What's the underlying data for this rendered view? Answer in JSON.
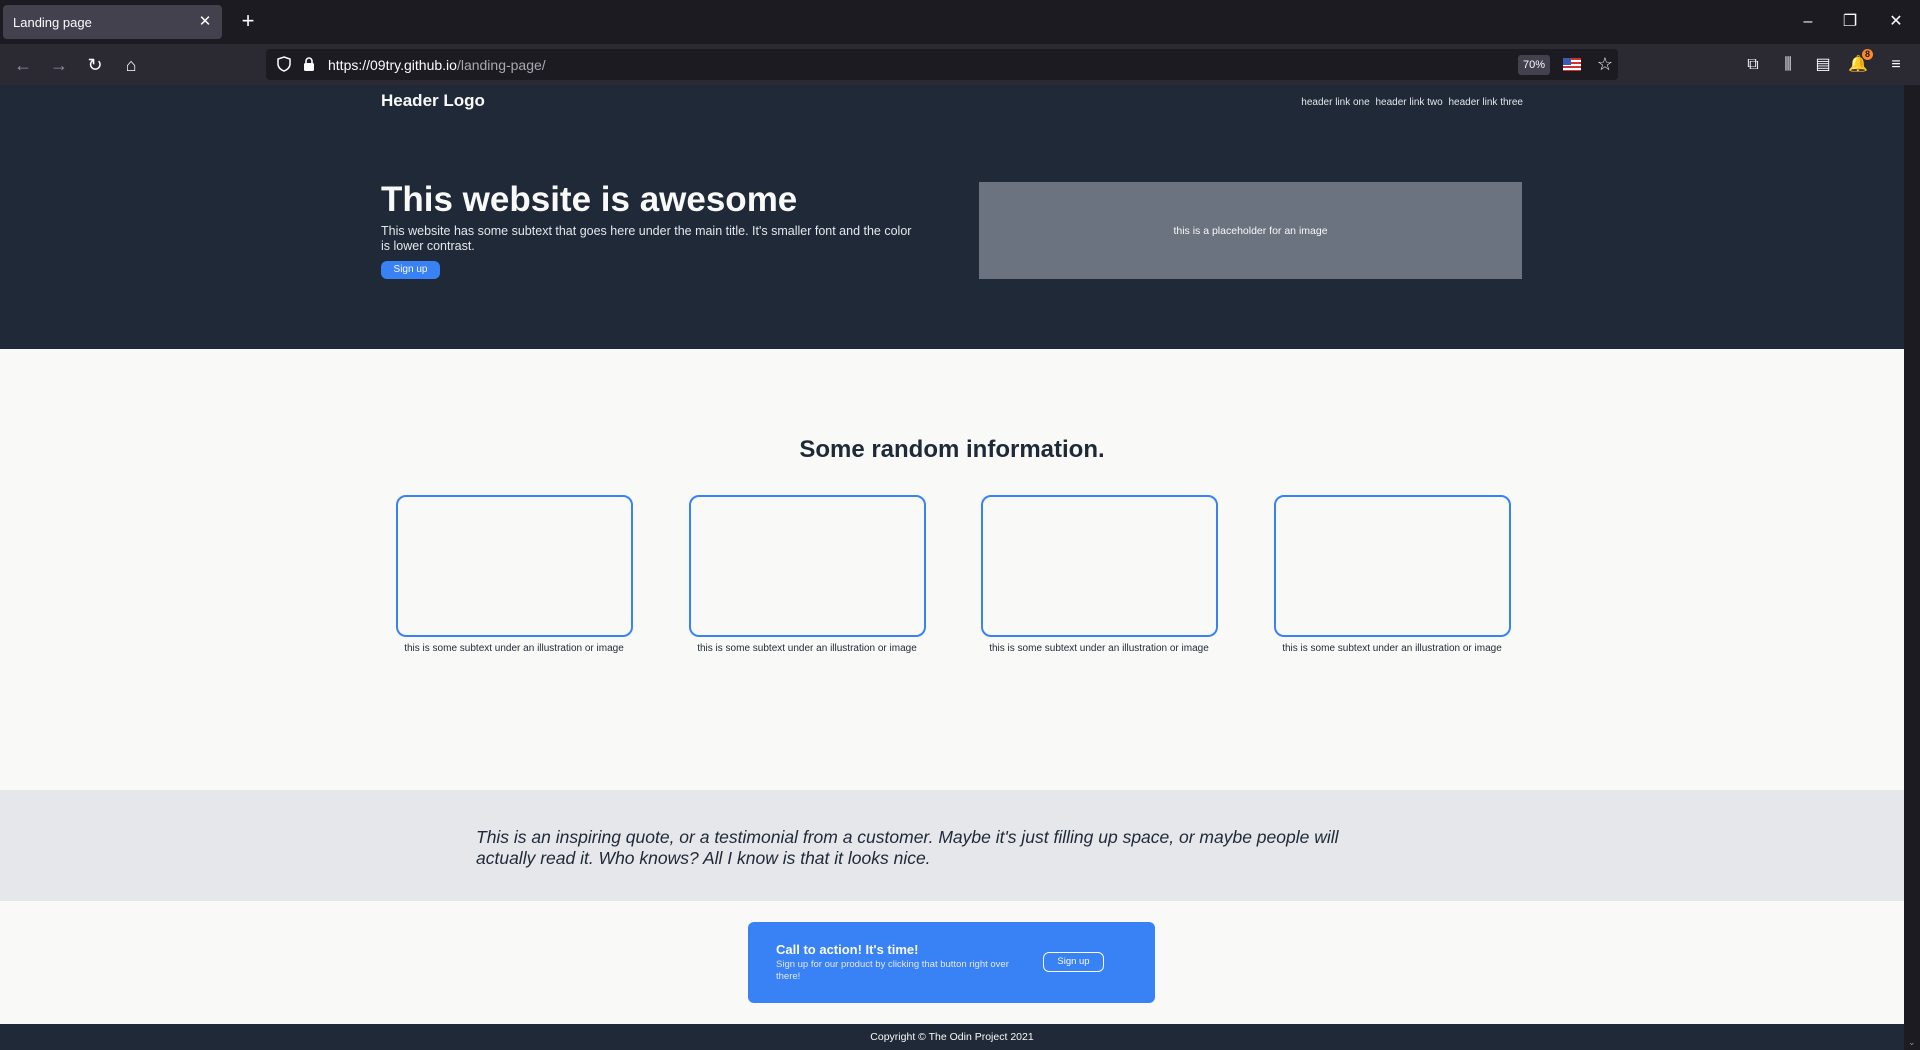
{
  "browser": {
    "tab_title": "Landing page",
    "url_host": "https://09try.github.io",
    "url_path": "/landing-page/",
    "zoom": "70%",
    "notification_count": "8",
    "icons": {
      "tab_close": "close-icon",
      "new_tab": "plus-icon",
      "minimize": "minimize-icon",
      "restore": "restore-icon",
      "close_window": "close-icon",
      "back": "arrow-left-icon",
      "forward": "arrow-right-icon",
      "reload": "reload-icon",
      "home": "home-icon",
      "tracking_protection": "shield-icon",
      "security": "lock-icon",
      "language": "us-flag-icon",
      "bookmark": "star-icon",
      "extensions": "extensions-icon",
      "library": "library-icon",
      "sidebar": "sidebar-icon",
      "notifications": "bell-icon",
      "menu": "hamburger-menu-icon"
    }
  },
  "page": {
    "header": {
      "logo": "Header Logo",
      "links": [
        "header link one",
        "header link two",
        "header link three"
      ]
    },
    "hero": {
      "title": "This website is awesome",
      "subtext": "This website has some subtext that goes here under the main title. It's smaller font and the color is lower contrast.",
      "button": "Sign up",
      "image_placeholder": "this is a placeholder for an image"
    },
    "info": {
      "title": "Some random information.",
      "cards": [
        {
          "caption": "this is some subtext under an illustration or image"
        },
        {
          "caption": "this is some subtext under an illustration or image"
        },
        {
          "caption": "this is some subtext under an illustration or image"
        },
        {
          "caption": "this is some subtext under an illustration or image"
        }
      ]
    },
    "quote": "This is an inspiring quote, or a testimonial from a customer. Maybe it's just filling up space, or maybe people will actually read it. Who knows? All I know is that it looks nice.",
    "cta": {
      "title": "Call to action! It's time!",
      "subtext": "Sign up for our product by clicking that button right over there!",
      "button": "Sign up"
    },
    "footer": "Copyright © The Odin Project 2021"
  },
  "colors": {
    "dark": "#1f2937",
    "light": "#f9faf8",
    "accent": "#3882f6",
    "placeholder": "#6b7280",
    "band": "#e5e7eb"
  }
}
